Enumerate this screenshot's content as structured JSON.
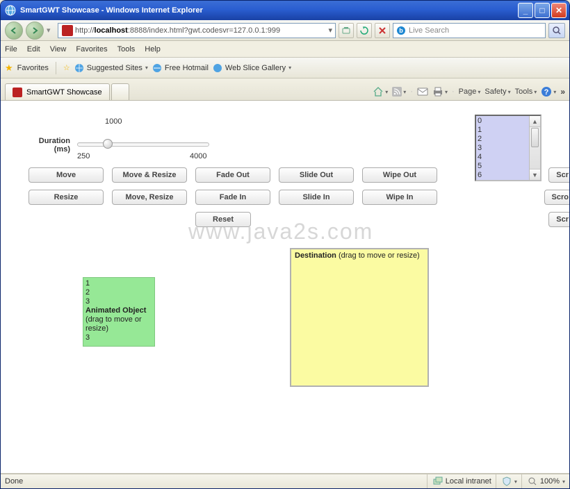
{
  "window": {
    "title": "SmartGWT Showcase - Windows Internet Explorer"
  },
  "address": {
    "prefix": "http://",
    "host": "localhost",
    "rest": ":8888/index.html?gwt.codesvr=127.0.0.1:999"
  },
  "search": {
    "placeholder": "Live Search"
  },
  "menus": [
    "File",
    "Edit",
    "View",
    "Favorites",
    "Tools",
    "Help"
  ],
  "fav": {
    "label": "Favorites",
    "suggested": "Suggested Sites",
    "hotmail": "Free Hotmail",
    "webslice": "Web Slice Gallery"
  },
  "tab": {
    "title": "SmartGWT Showcase"
  },
  "tabtools": {
    "page": "Page",
    "safety": "Safety",
    "tools": "Tools"
  },
  "slider": {
    "label1": "Duration",
    "label2": "(ms)",
    "top": "1000",
    "left": "250",
    "right": "4000"
  },
  "buttons": {
    "move": "Move",
    "moveresize": "Move & Resize",
    "fadeout": "Fade Out",
    "slideout": "Slide Out",
    "wipeout": "Wipe Out",
    "resize": "Resize",
    "moveresize2": "Move, Resize",
    "fadein": "Fade In",
    "slidein": "Slide In",
    "wipein": "Wipe In",
    "reset": "Reset"
  },
  "rightbuttons": {
    "r1": "Scr",
    "r2": "Scro",
    "r3": "Scr"
  },
  "listbox": [
    "0",
    "1",
    "2",
    "3",
    "4",
    "5",
    "6"
  ],
  "animbox": {
    "pre": "1\n2\n3",
    "boldtitle": "Animated Object",
    "rest": " (drag to move or resize)",
    "post": "3"
  },
  "destbox": {
    "bold": "Destination",
    "rest": " (drag to move or resize)"
  },
  "status": {
    "left": "Done",
    "zone": "Local intranet",
    "zoom": "100%"
  },
  "watermark": "www.java2s.com"
}
